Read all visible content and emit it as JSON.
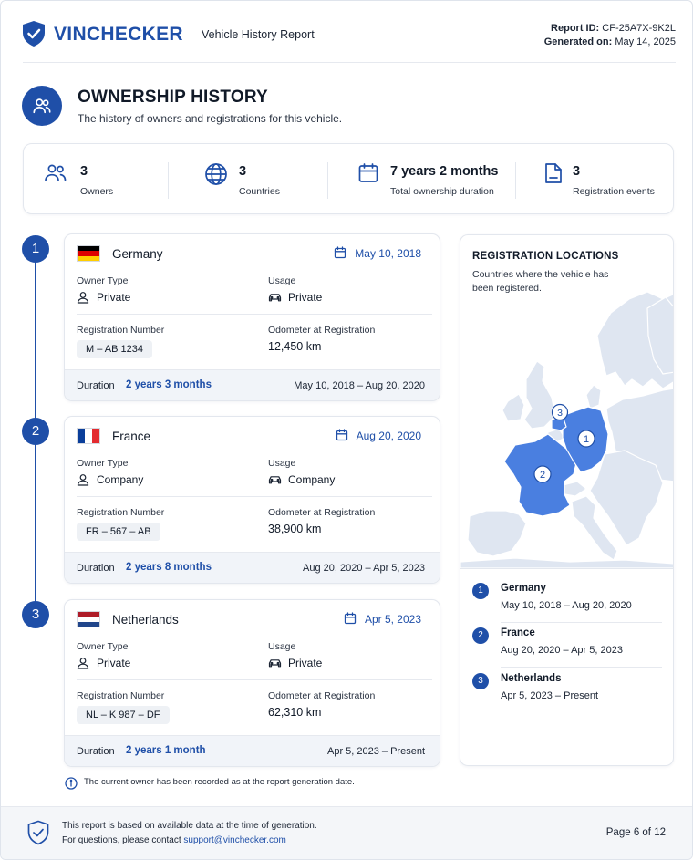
{
  "brand": "VINCHECKER",
  "doc_title": "Vehicle History Report",
  "report": {
    "id_label": "Report ID:",
    "id": "CF-25A7X-9K2L",
    "gen_label": "Generated on:",
    "generated": "May 14, 2025"
  },
  "section": {
    "title": "OWNERSHIP HISTORY",
    "subtitle": "The history of owners and registrations for this vehicle."
  },
  "stats": [
    {
      "icon": "users-icon",
      "value": "3",
      "label": "Owners"
    },
    {
      "icon": "globe-icon",
      "value": "3",
      "label": "Countries"
    },
    {
      "icon": "calendar-icon",
      "value": "7 years 2 months",
      "label": "Total ownership duration"
    },
    {
      "icon": "document-icon",
      "value": "3",
      "label": "Registration events"
    }
  ],
  "labels": {
    "owner_type": "Owner Type",
    "usage": "Usage",
    "reg_number": "Registration Number",
    "odometer": "Odometer at Registration",
    "duration": "Duration"
  },
  "owners": [
    {
      "step": "1",
      "country": "Germany",
      "flag": [
        "#000000",
        "#dd0000",
        "#ffce00"
      ],
      "flag_dir": "h",
      "date": "May 10, 2018",
      "owner_type": "Private",
      "usage": "Private",
      "reg_number": "M – AB 1234",
      "odometer": "12,450 km",
      "duration": "2 years 3 months",
      "range": "May 10, 2018 – Aug 20, 2020"
    },
    {
      "step": "2",
      "country": "France",
      "flag": [
        "#0a3e9a",
        "#ffffff",
        "#e32b2f"
      ],
      "flag_dir": "v",
      "date": "Aug 20, 2020",
      "owner_type": "Company",
      "usage": "Company",
      "reg_number": "FR – 567 – AB",
      "odometer": "38,900 km",
      "duration": "2 years 8 months",
      "range": "Aug 20, 2020 – Apr 5, 2023"
    },
    {
      "step": "3",
      "country": "Netherlands",
      "flag": [
        "#ae1c28",
        "#ffffff",
        "#21468b"
      ],
      "flag_dir": "h",
      "date": "Apr 5, 2023",
      "owner_type": "Private",
      "usage": "Private",
      "reg_number": "NL – K 987 – DF",
      "odometer": "62,310 km",
      "duration": "2 years 1 month",
      "range": "Apr 5, 2023 – Present"
    }
  ],
  "map": {
    "title": "REGISTRATION LOCATIONS",
    "subtitle": "Countries where the vehicle has been registered.",
    "markers": [
      "1",
      "2",
      "3"
    ],
    "highlight_color": "#4a7fe0",
    "base_color": "#dfe6f1",
    "legend": [
      {
        "num": "1",
        "country": "Germany",
        "range": "May 10, 2018 – Aug 20, 2020"
      },
      {
        "num": "2",
        "country": "France",
        "range": "Aug 20, 2020 – Apr 5, 2023"
      },
      {
        "num": "3",
        "country": "Netherlands",
        "range": "Apr 5, 2023 – Present"
      }
    ]
  },
  "note": "The current owner has been recorded as at the report generation date.",
  "footer": {
    "line1": "This report is based on available data at the time of generation.",
    "line2_prefix": "For questions, please contact ",
    "email": "support@vinchecker.com",
    "page": "Page 6 of 12"
  },
  "colors": {
    "accent": "#1f4fa8"
  }
}
